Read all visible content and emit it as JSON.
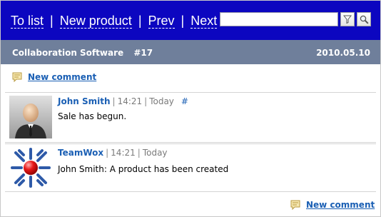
{
  "nav": {
    "to_list": "To list",
    "new_product": "New product",
    "prev": "Prev",
    "next": "Next",
    "separator": "|"
  },
  "search": {
    "value": "",
    "placeholder": "",
    "filter_icon": "filter-icon",
    "search_icon": "magnifier-icon"
  },
  "header": {
    "title": "Collaboration Software",
    "number": "#17",
    "date": "2010.05.10"
  },
  "actions": {
    "new_comment": "New comment"
  },
  "comments": [
    {
      "author": "John Smith",
      "time": "14:21",
      "day": "Today",
      "hash": "#",
      "text": "Sale has begun.",
      "avatar_icon": "user-avatar-icon"
    },
    {
      "author": "TeamWox",
      "time": "14:21",
      "day": "Today",
      "text": "John Smith: A product has been created",
      "avatar_icon": "teamwox-logo-icon"
    }
  ],
  "colors": {
    "topbar": "#0c06c0",
    "header": "#6f7f9b",
    "link": "#1a5fb4"
  }
}
